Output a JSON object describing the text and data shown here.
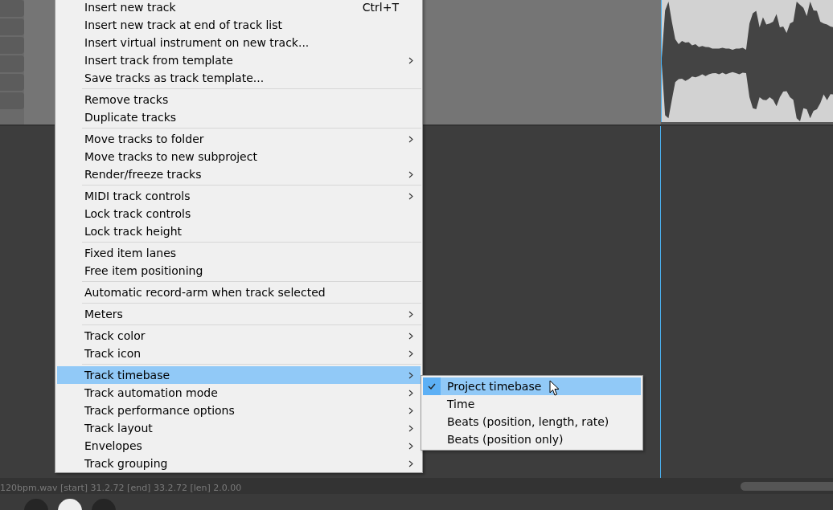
{
  "status_bar": {
    "text": "120bpm.wav [start] 31.2.72 [end] 33.2.72 [len] 2.0.00"
  },
  "context_menu": {
    "sections": [
      {
        "items": [
          {
            "label": "Insert new track",
            "shortcut": "Ctrl+T",
            "has_submenu": false,
            "selected": false
          },
          {
            "label": "Insert new track at end of track list",
            "has_submenu": false,
            "selected": false
          },
          {
            "label": "Insert virtual instrument on new track...",
            "has_submenu": false,
            "selected": false
          },
          {
            "label": "Insert track from template",
            "has_submenu": true,
            "selected": false
          },
          {
            "label": "Save tracks as track template...",
            "has_submenu": false,
            "selected": false
          }
        ]
      },
      {
        "items": [
          {
            "label": "Remove tracks",
            "has_submenu": false,
            "selected": false
          },
          {
            "label": "Duplicate tracks",
            "has_submenu": false,
            "selected": false
          }
        ]
      },
      {
        "items": [
          {
            "label": "Move tracks to folder",
            "has_submenu": true,
            "selected": false
          },
          {
            "label": "Move tracks to new subproject",
            "has_submenu": false,
            "selected": false
          },
          {
            "label": "Render/freeze tracks",
            "has_submenu": true,
            "selected": false
          }
        ]
      },
      {
        "items": [
          {
            "label": "MIDI track controls",
            "has_submenu": true,
            "selected": false
          },
          {
            "label": "Lock track controls",
            "has_submenu": false,
            "selected": false
          },
          {
            "label": "Lock track height",
            "has_submenu": false,
            "selected": false
          }
        ]
      },
      {
        "items": [
          {
            "label": "Fixed item lanes",
            "has_submenu": false,
            "selected": false
          },
          {
            "label": "Free item positioning",
            "has_submenu": false,
            "selected": false
          }
        ]
      },
      {
        "items": [
          {
            "label": "Automatic record-arm when track selected",
            "has_submenu": false,
            "selected": false
          }
        ]
      },
      {
        "items": [
          {
            "label": "Meters",
            "has_submenu": true,
            "selected": false
          }
        ]
      },
      {
        "items": [
          {
            "label": "Track color",
            "has_submenu": true,
            "selected": false
          },
          {
            "label": "Track icon",
            "has_submenu": true,
            "selected": false
          }
        ]
      },
      {
        "items": [
          {
            "label": "Track timebase",
            "has_submenu": true,
            "selected": true
          },
          {
            "label": "Track automation mode",
            "has_submenu": true,
            "selected": false
          },
          {
            "label": "Track performance options",
            "has_submenu": true,
            "selected": false
          },
          {
            "label": "Track layout",
            "has_submenu": true,
            "selected": false
          },
          {
            "label": "Envelopes",
            "has_submenu": true,
            "selected": false
          },
          {
            "label": "Track grouping",
            "has_submenu": true,
            "selected": false
          }
        ]
      }
    ]
  },
  "submenu": {
    "items": [
      {
        "label": "Project timebase",
        "checked": true,
        "selected": true
      },
      {
        "label": "Time",
        "checked": false,
        "selected": false
      },
      {
        "label": "Beats (position, length, rate)",
        "checked": false,
        "selected": false
      },
      {
        "label": "Beats (position only)",
        "checked": false,
        "selected": false
      }
    ]
  }
}
